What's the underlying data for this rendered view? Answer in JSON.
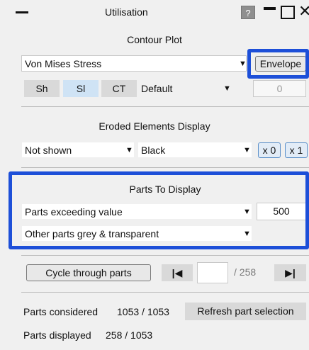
{
  "window": {
    "title": "Utilisation",
    "help_label": "?"
  },
  "contour": {
    "section_title": "Contour Plot",
    "quantity": "Von Mises Stress",
    "envelope_label": "Envelope",
    "sh_label": "Sh",
    "sl_label": "Sl",
    "ct_label": "CT",
    "scale_value": "Default",
    "scale_number": "0"
  },
  "eroded": {
    "section_title": "Eroded Elements Display",
    "display_value": "Not shown",
    "colour_value": "Black",
    "x0_label": "x 0",
    "x1_label": "x 1"
  },
  "parts": {
    "section_title": "Parts To Display",
    "filter_value": "Parts exceeding value",
    "threshold_value": "500",
    "other_parts_value": "Other parts grey & transparent"
  },
  "cycle": {
    "cycle_label": "Cycle through parts",
    "first_icon": "skip-to-first-icon",
    "last_icon": "skip-to-last-icon",
    "current_value": "",
    "total_label": "/ 258"
  },
  "status": {
    "considered_label": "Parts considered",
    "considered_value": "1053 / 1053",
    "refresh_label": "Refresh part selection",
    "displayed_label": "Parts displayed",
    "displayed_value": "258 / 1053"
  },
  "colors": {
    "highlight": "#1d4fd8",
    "panel_background": "#f0f0f0"
  }
}
